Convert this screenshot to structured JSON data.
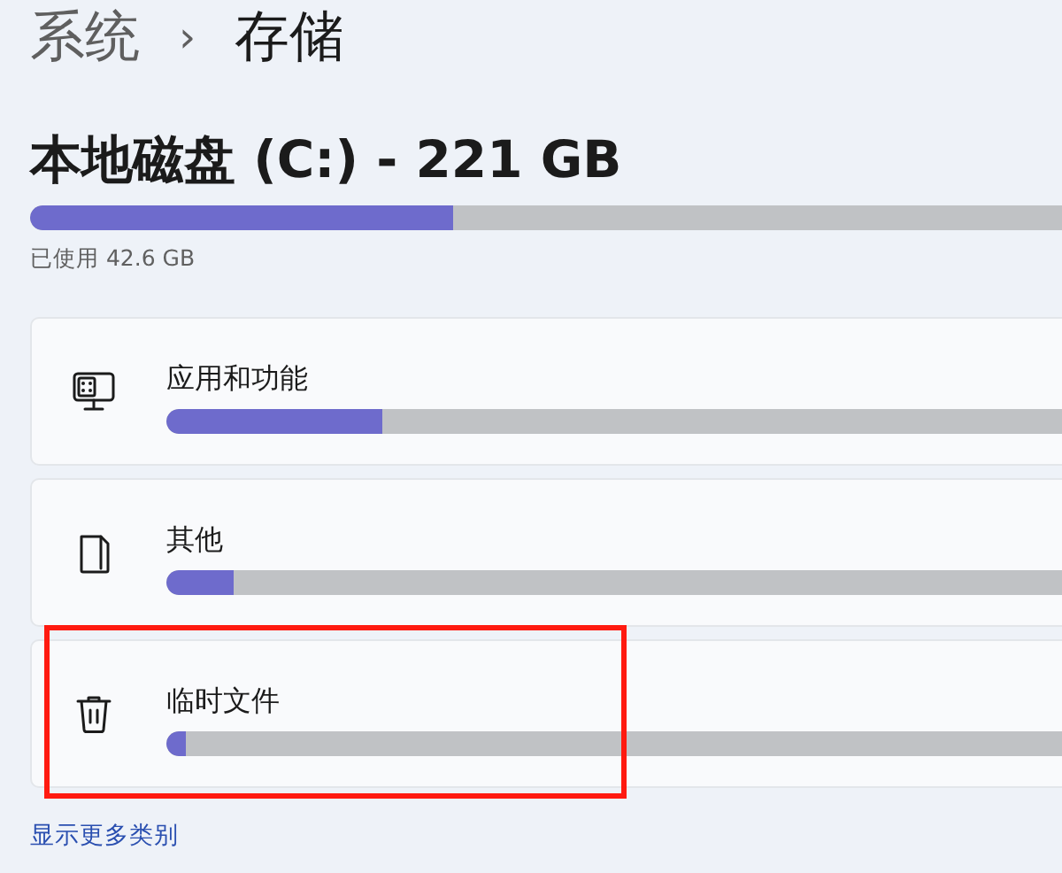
{
  "breadcrumb": {
    "parent": "系统",
    "separator": "›",
    "current": "存储"
  },
  "disk": {
    "title": "本地磁盘 (C:) - 221 GB",
    "level": 0.41,
    "used": "已使用 42.6 GB"
  },
  "categories": [
    {
      "kind": "apps",
      "label": "应用和功能",
      "level": 0.24,
      "highlighted": false
    },
    {
      "kind": "other",
      "label": "其他",
      "level": 0.075,
      "highlighted": false
    },
    {
      "kind": "temp",
      "label": "临时文件",
      "level": 0.022,
      "highlighted": true
    }
  ],
  "more_link": "显示更多类别"
}
